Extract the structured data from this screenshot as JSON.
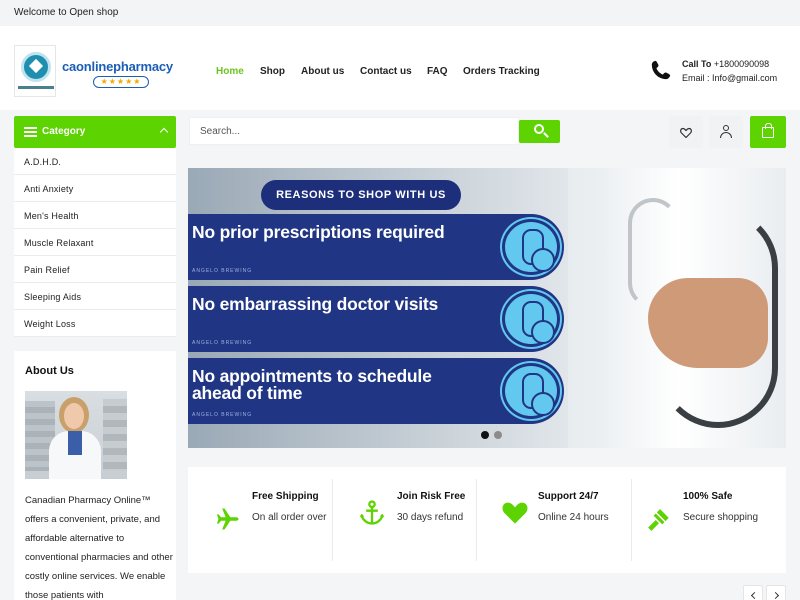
{
  "topbar": {
    "welcome": "Welcome to Open shop"
  },
  "brand": {
    "name": "caonlinepharmacy",
    "stars": "★★★★★",
    "logo_icon": "maple-leaf-logo-icon"
  },
  "nav": [
    {
      "label": "Home",
      "active": true
    },
    {
      "label": "Shop",
      "active": false
    },
    {
      "label": "About us",
      "active": false
    },
    {
      "label": "Contact us",
      "active": false
    },
    {
      "label": "FAQ",
      "active": false
    },
    {
      "label": "Orders Tracking",
      "active": false
    }
  ],
  "contact": {
    "call_label": "Call To",
    "phone": "+1800090098",
    "email_text": "Email : Info@gmail.com",
    "icon": "phone-icon"
  },
  "category": {
    "title": "Category",
    "items": [
      "A.D.H.D.",
      "Anti Anxiety",
      "Men's Health",
      "Muscle Relaxant",
      "Pain Relief",
      "Sleeping Aids",
      "Weight Loss"
    ]
  },
  "search": {
    "placeholder": "Search...",
    "value": ""
  },
  "header_icons": [
    "heart-icon",
    "user-icon",
    "shopping-bag-icon"
  ],
  "about": {
    "title": "About Us",
    "text": "Canadian Pharmacy Online™ offers a convenient, private, and affordable alternative to conventional pharmacies and other costly online services. We enable those patients with"
  },
  "banner": {
    "heading": "REASONS TO SHOP WITH US",
    "items": [
      {
        "text": "No prior prescriptions required",
        "sub": "ANGELO BREWING"
      },
      {
        "text": "No embarrassing doctor visits",
        "sub": "ANGELO BREWING"
      },
      {
        "text": "No appointments to schedule ahead of time",
        "sub": "ANGELO BREWING"
      }
    ],
    "slides": 2,
    "active_slide": 1
  },
  "features": [
    {
      "icon": "airplane-icon",
      "title": "Free Shipping",
      "desc": "On all order over"
    },
    {
      "icon": "anchor-icon",
      "title": "Join Risk Free",
      "desc": "30 days refund"
    },
    {
      "icon": "heart-icon",
      "title": "Support 24/7",
      "desc": "Online 24 hours"
    },
    {
      "icon": "gavel-icon",
      "title": "100% Safe",
      "desc": "Secure shopping"
    }
  ],
  "colors": {
    "accent": "#5ed302",
    "brand_blue": "#1b5db7",
    "banner_navy": "#203584",
    "banner_cyan": "#63c8ef"
  }
}
